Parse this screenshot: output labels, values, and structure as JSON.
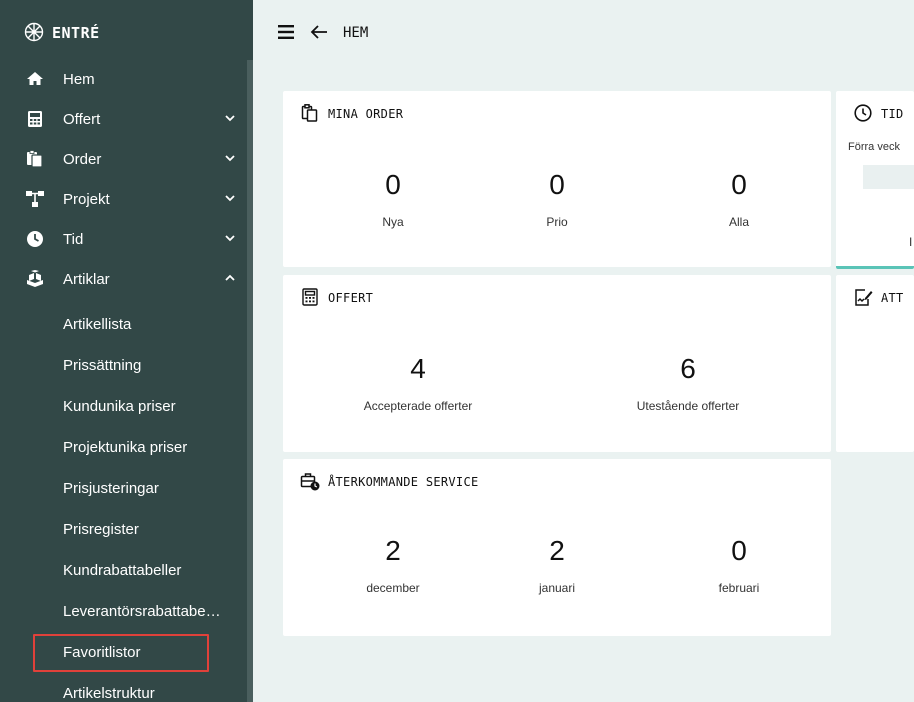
{
  "brand": {
    "name": "ENTRÉ",
    "icon": "brand-logo-icon"
  },
  "nav": [
    {
      "label": "Hem",
      "icon": "home-icon",
      "chevron": ""
    },
    {
      "label": "Offert",
      "icon": "calculator-icon",
      "chevron": "down"
    },
    {
      "label": "Order",
      "icon": "clipboard-icon",
      "chevron": "down"
    },
    {
      "label": "Projekt",
      "icon": "sitemap-icon",
      "chevron": "down"
    },
    {
      "label": "Tid",
      "icon": "clock-icon",
      "chevron": "down"
    },
    {
      "label": "Artiklar",
      "icon": "boxes-icon",
      "chevron": "up"
    }
  ],
  "subnav": [
    "Artikellista",
    "Prissättning",
    "Kundunika priser",
    "Projektunika priser",
    "Prisjusteringar",
    "Prisregister",
    "Kundrabattabeller",
    "Leverantörsrabattabe…",
    "Favoritlistor",
    "Artikelstruktur"
  ],
  "selected_subnav": "Favoritlistor",
  "topbar": {
    "menu_icon": "hamburger-icon",
    "back_icon": "arrow-left-icon",
    "title": "HEM"
  },
  "cards": {
    "orders": {
      "title": "MINA ORDER",
      "icon": "clipboard-outline-icon",
      "stats": [
        {
          "value": "0",
          "label": "Nya"
        },
        {
          "value": "0",
          "label": "Prio"
        },
        {
          "value": "0",
          "label": "Alla"
        }
      ]
    },
    "offert": {
      "title": "OFFERT",
      "icon": "calculator-outline-icon",
      "stats": [
        {
          "value": "4",
          "label": "Accepterade offerter"
        },
        {
          "value": "6",
          "label": "Utestående offerter"
        }
      ]
    },
    "service": {
      "title": "ÅTERKOMMANDE SERVICE",
      "icon": "briefcase-clock-icon",
      "stats": [
        {
          "value": "2",
          "label": "december"
        },
        {
          "value": "2",
          "label": "januari"
        },
        {
          "value": "0",
          "label": "februari"
        }
      ]
    },
    "tid": {
      "title": "TID",
      "icon": "clock-outline-icon",
      "subtitle": "Förra veck",
      "letter": "I"
    },
    "att": {
      "title": "ATT",
      "icon": "file-signature-icon"
    }
  },
  "colors": {
    "sidebar": "#324847",
    "background": "#eaf2f1",
    "accent": "#5ac4b7",
    "highlight": "#e0413a"
  }
}
